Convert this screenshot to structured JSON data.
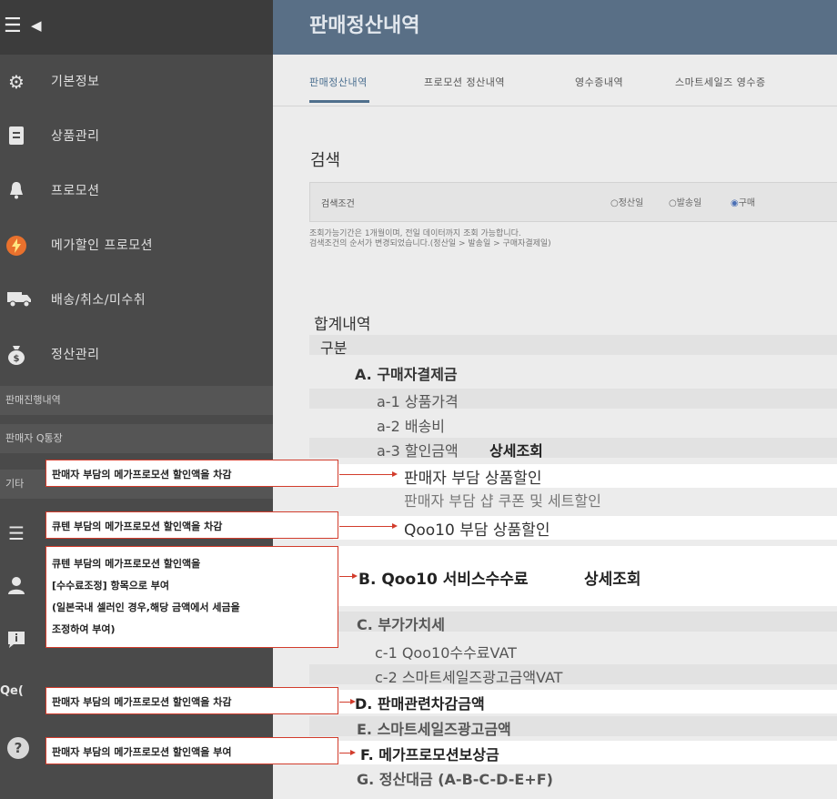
{
  "sidebar": {
    "items": [
      {
        "label": "기본정보"
      },
      {
        "label": "상품관리"
      },
      {
        "label": "프로모션"
      },
      {
        "label": "메가할인 프로모션"
      },
      {
        "label": "배송/취소/미수취"
      },
      {
        "label": "정산관리"
      }
    ],
    "sub_items": [
      {
        "label": "판매진행내역"
      },
      {
        "label": "판매자 Q통장"
      },
      {
        "label": "기타"
      }
    ],
    "partial_text": "Qe("
  },
  "header": {
    "title": "판매정산내역"
  },
  "tabs": [
    {
      "label": "판매정산내역"
    },
    {
      "label": "프로모션 정산내역"
    },
    {
      "label": "영수증내역"
    },
    {
      "label": "스마트세일즈 영수증"
    }
  ],
  "search": {
    "title": "검색",
    "condition_label": "검색조건",
    "radios": [
      {
        "label": "정산일"
      },
      {
        "label": "발송일"
      },
      {
        "label": "구매"
      }
    ],
    "notes": [
      "조회가능기간은 1개월이며, 전일 데이터까지 조회 가능합니다.",
      "검색조건의 순서가 변경되었습니다.(정산일 > 발송일 > 구매자결제일)"
    ]
  },
  "summary": {
    "title": "합계내역",
    "header": "구분",
    "rows": {
      "a": "A. 구매자결제금",
      "a1": "a-1 상품가격",
      "a2": "a-2 배송비",
      "a3": "a-3 할인금액",
      "a3_link": "상세조회",
      "a3_1": "판매자 부담 상품할인",
      "a3_2": "판매자 부담 샵 쿠폰 및 세트할인",
      "a3_3": "Qoo10 부담 상품할인",
      "b": "B. Qoo10 서비스수수료",
      "b_link": "상세조회",
      "c": "C. 부가가치세",
      "c1": "c-1 Qoo10수수료VAT",
      "c2": "c-2 스마트세일즈광고금액VAT",
      "d": "D. 판매관련차감금액",
      "e": "E. 스마트세일즈광고금액",
      "f": "F. 메가프로모션보상금",
      "g": "G. 정산대금 (A-B-C-D-E+F)"
    }
  },
  "callouts": {
    "c1": "판매자 부담의 메가프로모션 할인액을 차감",
    "c2": "큐텐 부담의 메가프로모션 할인액을 차감",
    "c3_lines": [
      "큐텐 부담의 메가프로모션 할인액을",
      "[수수료조정] 항목으로 부여",
      "(일본국내 셀러인 경우,해당 금액에서 세금을",
      "조정하여 부여)"
    ],
    "c4": "판매자 부담의 메가프로모션 할인액을 차감",
    "c5": "판매자 부담의 메가프로모션 할인액을 부여"
  },
  "colors": {
    "sidebar_bg": "#4a4a4a",
    "header_bg": "#596f86",
    "callout_border": "#d23c2c",
    "active_tab": "#4a6e8f"
  }
}
